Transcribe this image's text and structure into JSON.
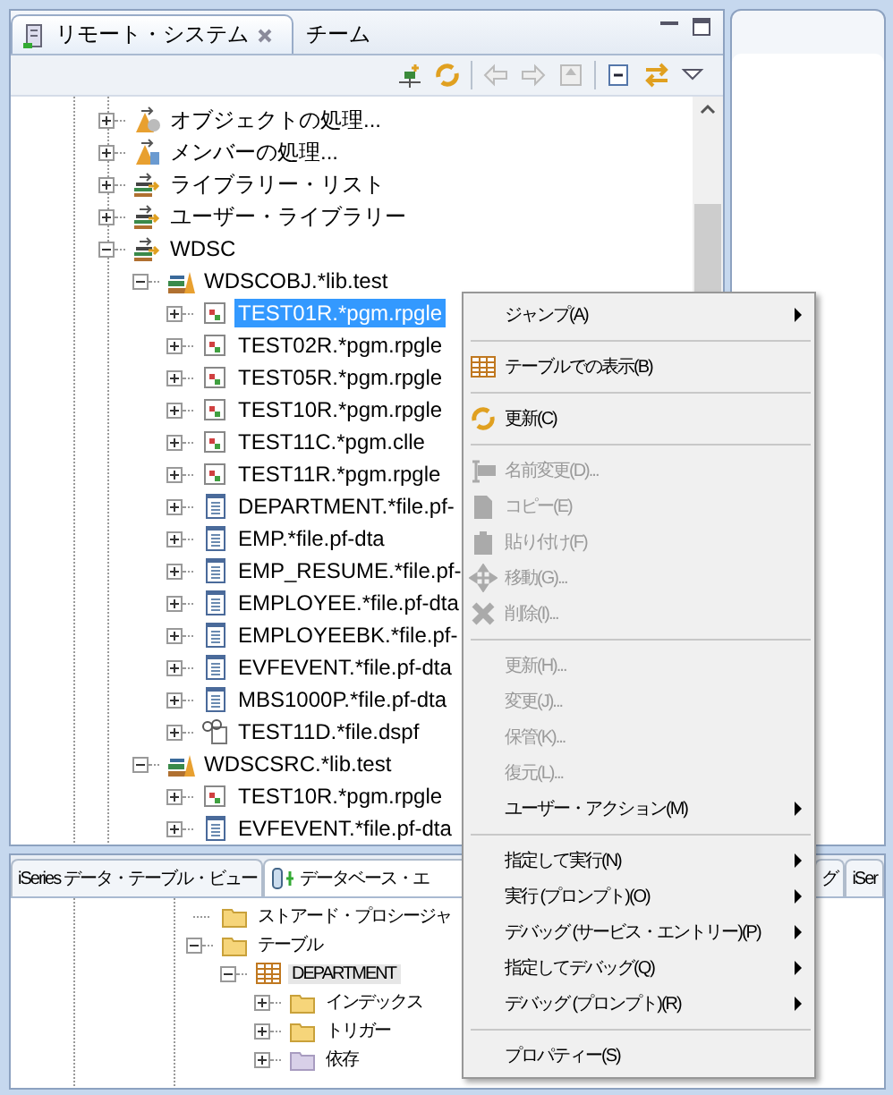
{
  "top_panel": {
    "active": true,
    "tabs": [
      {
        "label": "リモート・システム",
        "selected": true,
        "closable": true
      },
      {
        "label": "チーム",
        "selected": false,
        "closable": false
      }
    ],
    "tree": [
      {
        "label": "オブジェクトの処理...",
        "kind": "work-objects",
        "expanded": false,
        "selected": false
      },
      {
        "label": "メンバーの処理...",
        "kind": "work-members",
        "expanded": false,
        "selected": false
      },
      {
        "label": "ライブラリー・リスト",
        "kind": "library-list",
        "expanded": false,
        "selected": false
      },
      {
        "label": "ユーザー・ライブラリー",
        "kind": "library-list",
        "expanded": false,
        "selected": false
      },
      {
        "label": "WDSC",
        "kind": "library-list",
        "expanded": true,
        "selected": false,
        "children": [
          {
            "label": "WDSCOBJ.*lib.test",
            "kind": "library",
            "expanded": true,
            "selected": false,
            "children": [
              {
                "label": "TEST01R.*pgm.rpgle",
                "kind": "program",
                "expanded": false,
                "selected": true
              },
              {
                "label": "TEST02R.*pgm.rpgle",
                "kind": "program",
                "expanded": false,
                "selected": false
              },
              {
                "label": "TEST05R.*pgm.rpgle",
                "kind": "program",
                "expanded": false,
                "selected": false
              },
              {
                "label": "TEST10R.*pgm.rpgle",
                "kind": "program",
                "expanded": false,
                "selected": false
              },
              {
                "label": "TEST11C.*pgm.clle",
                "kind": "program",
                "expanded": false,
                "selected": false
              },
              {
                "label": "TEST11R.*pgm.rpgle",
                "kind": "program",
                "expanded": false,
                "selected": false
              },
              {
                "label": "DEPARTMENT.*file.pf-",
                "kind": "file",
                "expanded": false,
                "selected": false
              },
              {
                "label": "EMP.*file.pf-dta",
                "kind": "file",
                "expanded": false,
                "selected": false
              },
              {
                "label": "EMP_RESUME.*file.pf-",
                "kind": "file",
                "expanded": false,
                "selected": false
              },
              {
                "label": "EMPLOYEE.*file.pf-dta",
                "kind": "file",
                "expanded": false,
                "selected": false
              },
              {
                "label": "EMPLOYEEBK.*file.pf-",
                "kind": "file",
                "expanded": false,
                "selected": false
              },
              {
                "label": "EVFEVENT.*file.pf-dta",
                "kind": "file",
                "expanded": false,
                "selected": false
              },
              {
                "label": "MBS1000P.*file.pf-dta",
                "kind": "file",
                "expanded": false,
                "selected": false
              },
              {
                "label": "TEST11D.*file.dspf",
                "kind": "display-file",
                "expanded": false,
                "selected": false
              }
            ]
          },
          {
            "label": "WDSCSRC.*lib.test",
            "kind": "library",
            "expanded": true,
            "selected": false,
            "children": [
              {
                "label": "TEST10R.*pgm.rpgle",
                "kind": "program",
                "expanded": false,
                "selected": false
              },
              {
                "label": "EVFEVENT.*file.pf-dta",
                "kind": "file",
                "expanded": false,
                "selected": false
              }
            ]
          }
        ]
      }
    ]
  },
  "bottom_panel": {
    "active": false,
    "tabs": [
      {
        "label": "iSeries データ・テーブル・ビュー",
        "selected": false
      },
      {
        "label": "データベース・エ",
        "selected": true
      },
      {
        "label": "グ",
        "selected": false
      },
      {
        "label": "iSer",
        "selected": false
      }
    ],
    "tree": [
      {
        "label": "ストアード・プロシージャ",
        "kind": "folder",
        "selected": false
      },
      {
        "label": "テーブル",
        "kind": "folder",
        "expanded": true,
        "selected": false,
        "children": [
          {
            "label": "DEPARTMENT",
            "kind": "table",
            "expanded": true,
            "selected": true,
            "children": [
              {
                "label": "インデックス",
                "kind": "folder",
                "expanded": false,
                "selected": false
              },
              {
                "label": "トリガー",
                "kind": "folder",
                "expanded": false,
                "selected": false
              },
              {
                "label": "依存",
                "kind": "folder-dim",
                "expanded": false,
                "selected": false
              }
            ]
          }
        ]
      }
    ]
  },
  "context_menu": {
    "items": [
      {
        "kind": "plain",
        "label": "ジャンプ(A)",
        "disabled": false,
        "submenu": true
      },
      {
        "kind": "separator"
      },
      {
        "kind": "table",
        "label": "テーブルでの表示(B)",
        "disabled": false,
        "submenu": false
      },
      {
        "kind": "separator"
      },
      {
        "kind": "refresh",
        "label": "更新(C)",
        "disabled": false,
        "submenu": false
      },
      {
        "kind": "separator"
      },
      {
        "kind": "rename",
        "label": "名前変更(D)...",
        "disabled": true,
        "submenu": false
      },
      {
        "kind": "copy",
        "label": "コピー(E)",
        "disabled": true,
        "submenu": false
      },
      {
        "kind": "paste",
        "label": "貼り付け(F)",
        "disabled": true,
        "submenu": false
      },
      {
        "kind": "move",
        "label": "移動(G)...",
        "disabled": true,
        "submenu": false
      },
      {
        "kind": "delete",
        "label": "削除(I)...",
        "disabled": true,
        "submenu": false
      },
      {
        "kind": "separator"
      },
      {
        "kind": "plain",
        "label": "更新(H)...",
        "disabled": true,
        "submenu": false
      },
      {
        "kind": "plain",
        "label": "変更(J)...",
        "disabled": true,
        "submenu": false
      },
      {
        "kind": "plain",
        "label": "保管(K)...",
        "disabled": true,
        "submenu": false
      },
      {
        "kind": "plain",
        "label": "復元(L)...",
        "disabled": true,
        "submenu": false
      },
      {
        "kind": "plain",
        "label": "ユーザー・アクション(M)",
        "disabled": false,
        "submenu": true
      },
      {
        "kind": "separator"
      },
      {
        "kind": "plain",
        "label": "指定して実行(N)",
        "disabled": false,
        "submenu": true
      },
      {
        "kind": "plain",
        "label": "実行 (プロンプト)(O)",
        "disabled": false,
        "submenu": true
      },
      {
        "kind": "plain",
        "label": "デバッグ (サービス・エントリー)(P)",
        "disabled": false,
        "submenu": true
      },
      {
        "kind": "plain",
        "label": "指定してデバッグ(Q)",
        "disabled": false,
        "submenu": true
      },
      {
        "kind": "plain",
        "label": "デバッグ (プロンプト)(R)",
        "disabled": false,
        "submenu": true
      },
      {
        "kind": "separator"
      },
      {
        "kind": "plain",
        "label": "プロパティー(S)",
        "disabled": false,
        "submenu": false
      }
    ]
  }
}
